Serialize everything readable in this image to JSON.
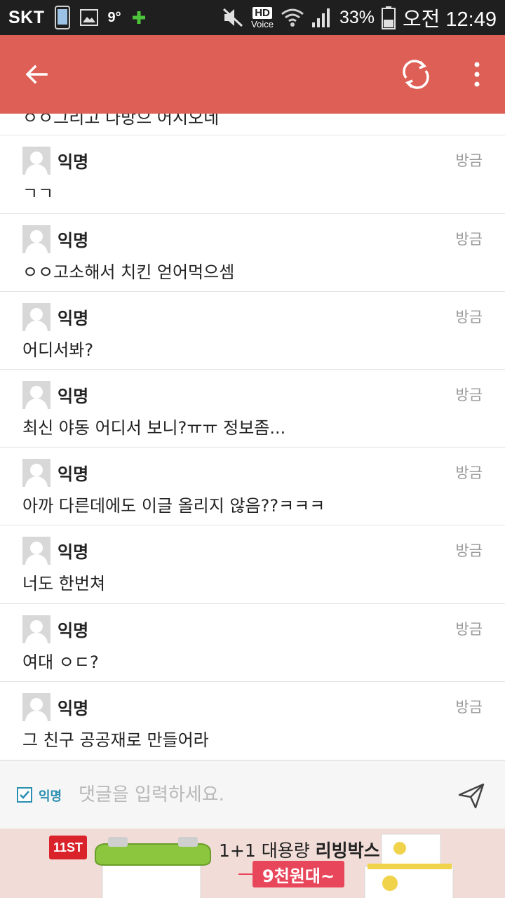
{
  "status_bar": {
    "carrier": "SKT",
    "temperature": "9°",
    "battery": "33%",
    "hd_label": "HD",
    "voice_label": "Voice",
    "time": "오전 12:49"
  },
  "app_bar": {
    "background": "#de5f55"
  },
  "partial_comment": "ㅇㅇ그리고 다방으 어시오네",
  "comments": [
    {
      "author": "익명",
      "time": "방금",
      "text": "ㄱㄱ"
    },
    {
      "author": "익명",
      "time": "방금",
      "text": "ㅇㅇ고소해서 치킨 얻어먹으셈"
    },
    {
      "author": "익명",
      "time": "방금",
      "text": "어디서봐?"
    },
    {
      "author": "익명",
      "time": "방금",
      "text": "최신 야동 어디서 보니?ㅠㅠ 정보좀..."
    },
    {
      "author": "익명",
      "time": "방금",
      "text": "아까 다른데에도 이글 올리지 않음??ㅋㅋㅋ"
    },
    {
      "author": "익명",
      "time": "방금",
      "text": "너도 한번쳐"
    },
    {
      "author": "익명",
      "time": "방금",
      "text": "여대 ㅇㄷ?"
    },
    {
      "author": "익명",
      "time": "방금",
      "text": "그 친구 공공재로 만들어라"
    }
  ],
  "input_bar": {
    "anonymous_label": "익명",
    "anonymous_checked": true,
    "placeholder": "댓글을 입력하세요."
  },
  "ad": {
    "logo": "11ST",
    "headline_prefix": "1+1 대용량 ",
    "headline_bold": "리빙박스",
    "price": "9천원대~"
  }
}
